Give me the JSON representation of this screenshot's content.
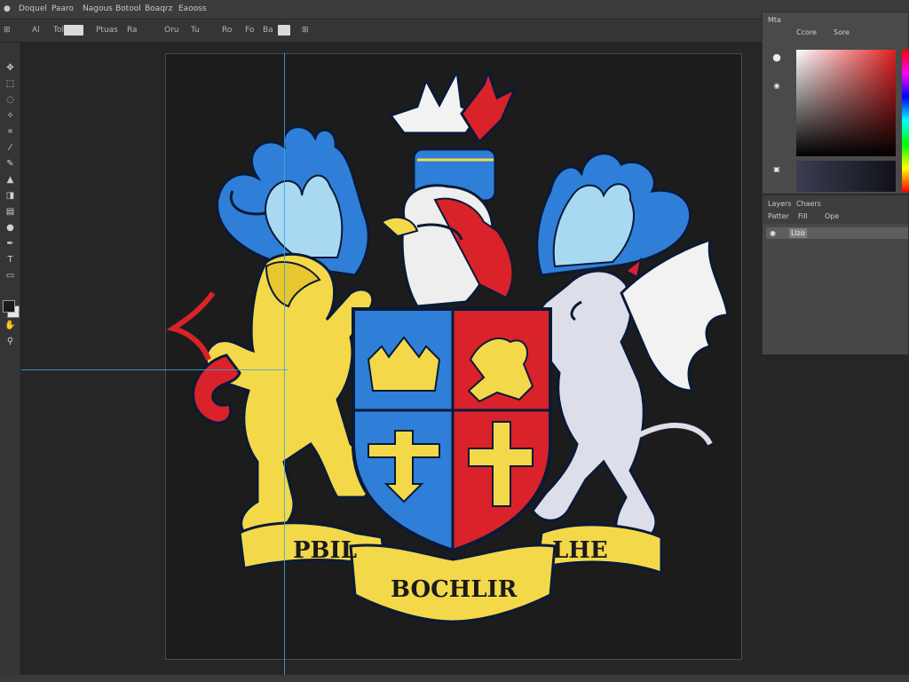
{
  "menubar": {
    "items": [
      "Doquel",
      "Paaro",
      "Nagous",
      "Botool",
      "Boaqrz",
      "Eaooss"
    ]
  },
  "options": {
    "labels": [
      "⊞",
      "Al",
      "Toloo",
      "Ptuas",
      "Ra",
      "Oru",
      "Tu",
      "Ro",
      "Fo",
      "Ba"
    ]
  },
  "panels": {
    "color_tabs": [
      "Mta",
      "Ccore",
      "Sore"
    ],
    "layers_tabs": [
      "Layers",
      "Chaers",
      "Patter",
      "Fill",
      "Ope"
    ],
    "layer_name": "Llzo"
  },
  "emblem": {
    "banner_left": "PBIL",
    "banner_center": "BOCHLIR",
    "banner_right": "LHE"
  },
  "colors": {
    "shield_blue": "#2f7fd8",
    "shield_red": "#d9222a",
    "gold": "#f3d94a",
    "silver": "#dcdfea",
    "guide": "#3ea6d6"
  },
  "icons": [
    "move-icon",
    "marquee-icon",
    "lasso-icon",
    "magic-wand-icon",
    "crop-icon",
    "eyedropper-icon",
    "brush-icon",
    "stamp-icon",
    "eraser-icon",
    "gradient-icon",
    "blur-icon",
    "pen-icon",
    "text-icon",
    "shape-icon",
    "hand-icon",
    "zoom-icon"
  ]
}
